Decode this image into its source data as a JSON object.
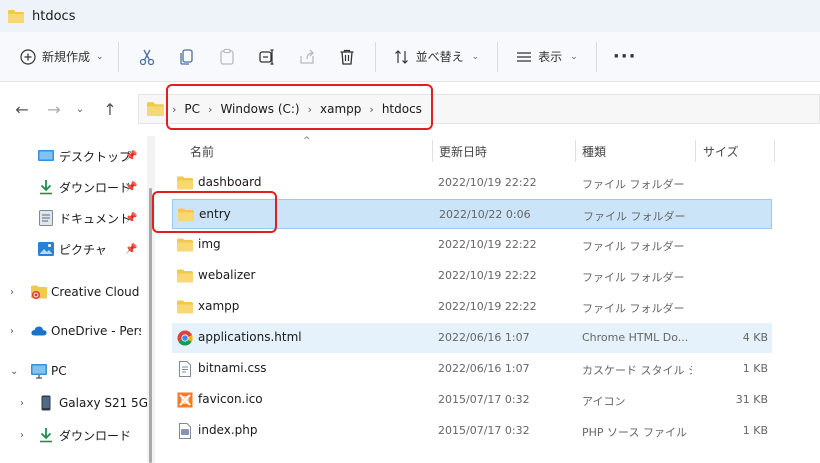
{
  "window": {
    "title": "htdocs"
  },
  "toolbar": {
    "new_label": "新規作成",
    "sort_label": "並べ替え",
    "view_label": "表示",
    "more_label": "···"
  },
  "address": {
    "crumbs": [
      "PC",
      "Windows (C:)",
      "xampp",
      "htdocs"
    ]
  },
  "sidebar": {
    "items": [
      {
        "label": "デスクトップ",
        "icon": "desktop-icon",
        "pinned": true
      },
      {
        "label": "ダウンロード",
        "icon": "download-icon",
        "pinned": true
      },
      {
        "label": "ドキュメント",
        "icon": "documents-icon",
        "pinned": true
      },
      {
        "label": "ピクチャ",
        "icon": "pictures-icon",
        "pinned": true
      },
      {
        "label": "Creative Cloud Fi",
        "icon": "creative-cloud-icon",
        "expandable": true
      },
      {
        "label": "OneDrive - Perso",
        "icon": "onedrive-icon",
        "expandable": true
      },
      {
        "label": "PC",
        "icon": "pc-icon",
        "expanded": true
      },
      {
        "label": "Galaxy S21 5G",
        "icon": "phone-icon",
        "expandable": true
      },
      {
        "label": "ダウンロード",
        "icon": "download-icon",
        "expandable": true
      }
    ]
  },
  "columns": {
    "name": "名前",
    "date": "更新日時",
    "type": "種類",
    "size": "サイズ"
  },
  "files": [
    {
      "name": "dashboard",
      "date": "2022/10/19 22:22",
      "type": "ファイル フォルダー",
      "size": "",
      "icon": "folder-icon"
    },
    {
      "name": "entry",
      "date": "2022/10/22 0:06",
      "type": "ファイル フォルダー",
      "size": "",
      "icon": "folder-icon",
      "selected": true
    },
    {
      "name": "img",
      "date": "2022/10/19 22:22",
      "type": "ファイル フォルダー",
      "size": "",
      "icon": "folder-icon"
    },
    {
      "name": "webalizer",
      "date": "2022/10/19 22:22",
      "type": "ファイル フォルダー",
      "size": "",
      "icon": "folder-icon"
    },
    {
      "name": "xampp",
      "date": "2022/10/19 22:22",
      "type": "ファイル フォルダー",
      "size": "",
      "icon": "folder-icon"
    },
    {
      "name": "applications.html",
      "date": "2022/06/16 1:07",
      "type": "Chrome HTML Do...",
      "size": "4 KB",
      "icon": "chrome-html-icon",
      "hovered": true
    },
    {
      "name": "bitnami.css",
      "date": "2022/06/16 1:07",
      "type": "カスケード スタイル シ...",
      "size": "1 KB",
      "icon": "css-file-icon"
    },
    {
      "name": "favicon.ico",
      "date": "2015/07/17 0:32",
      "type": "アイコン",
      "size": "31 KB",
      "icon": "ico-file-icon"
    },
    {
      "name": "index.php",
      "date": "2015/07/17 0:32",
      "type": "PHP ソース ファイル",
      "size": "1 KB",
      "icon": "php-file-icon"
    }
  ],
  "colors": {
    "folder": "#f2c94c",
    "selection": "#cce4f7",
    "annotation": "#e02020"
  }
}
